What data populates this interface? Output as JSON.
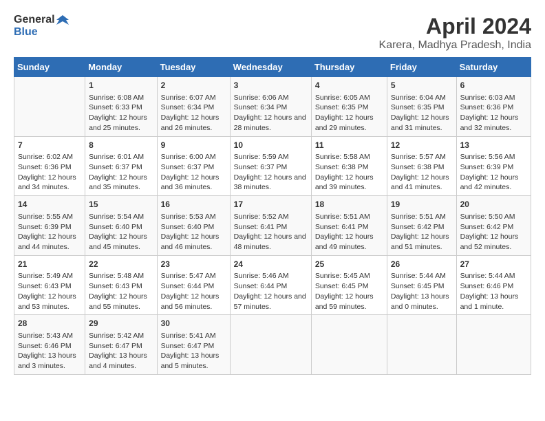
{
  "header": {
    "logo_general": "General",
    "logo_blue": "Blue",
    "title": "April 2024",
    "subtitle": "Karera, Madhya Pradesh, India"
  },
  "columns": [
    "Sunday",
    "Monday",
    "Tuesday",
    "Wednesday",
    "Thursday",
    "Friday",
    "Saturday"
  ],
  "weeks": [
    [
      {
        "day": "",
        "sunrise": "",
        "sunset": "",
        "daylight": ""
      },
      {
        "day": "1",
        "sunrise": "Sunrise: 6:08 AM",
        "sunset": "Sunset: 6:33 PM",
        "daylight": "Daylight: 12 hours and 25 minutes."
      },
      {
        "day": "2",
        "sunrise": "Sunrise: 6:07 AM",
        "sunset": "Sunset: 6:34 PM",
        "daylight": "Daylight: 12 hours and 26 minutes."
      },
      {
        "day": "3",
        "sunrise": "Sunrise: 6:06 AM",
        "sunset": "Sunset: 6:34 PM",
        "daylight": "Daylight: 12 hours and 28 minutes."
      },
      {
        "day": "4",
        "sunrise": "Sunrise: 6:05 AM",
        "sunset": "Sunset: 6:35 PM",
        "daylight": "Daylight: 12 hours and 29 minutes."
      },
      {
        "day": "5",
        "sunrise": "Sunrise: 6:04 AM",
        "sunset": "Sunset: 6:35 PM",
        "daylight": "Daylight: 12 hours and 31 minutes."
      },
      {
        "day": "6",
        "sunrise": "Sunrise: 6:03 AM",
        "sunset": "Sunset: 6:36 PM",
        "daylight": "Daylight: 12 hours and 32 minutes."
      }
    ],
    [
      {
        "day": "7",
        "sunrise": "Sunrise: 6:02 AM",
        "sunset": "Sunset: 6:36 PM",
        "daylight": "Daylight: 12 hours and 34 minutes."
      },
      {
        "day": "8",
        "sunrise": "Sunrise: 6:01 AM",
        "sunset": "Sunset: 6:37 PM",
        "daylight": "Daylight: 12 hours and 35 minutes."
      },
      {
        "day": "9",
        "sunrise": "Sunrise: 6:00 AM",
        "sunset": "Sunset: 6:37 PM",
        "daylight": "Daylight: 12 hours and 36 minutes."
      },
      {
        "day": "10",
        "sunrise": "Sunrise: 5:59 AM",
        "sunset": "Sunset: 6:37 PM",
        "daylight": "Daylight: 12 hours and 38 minutes."
      },
      {
        "day": "11",
        "sunrise": "Sunrise: 5:58 AM",
        "sunset": "Sunset: 6:38 PM",
        "daylight": "Daylight: 12 hours and 39 minutes."
      },
      {
        "day": "12",
        "sunrise": "Sunrise: 5:57 AM",
        "sunset": "Sunset: 6:38 PM",
        "daylight": "Daylight: 12 hours and 41 minutes."
      },
      {
        "day": "13",
        "sunrise": "Sunrise: 5:56 AM",
        "sunset": "Sunset: 6:39 PM",
        "daylight": "Daylight: 12 hours and 42 minutes."
      }
    ],
    [
      {
        "day": "14",
        "sunrise": "Sunrise: 5:55 AM",
        "sunset": "Sunset: 6:39 PM",
        "daylight": "Daylight: 12 hours and 44 minutes."
      },
      {
        "day": "15",
        "sunrise": "Sunrise: 5:54 AM",
        "sunset": "Sunset: 6:40 PM",
        "daylight": "Daylight: 12 hours and 45 minutes."
      },
      {
        "day": "16",
        "sunrise": "Sunrise: 5:53 AM",
        "sunset": "Sunset: 6:40 PM",
        "daylight": "Daylight: 12 hours and 46 minutes."
      },
      {
        "day": "17",
        "sunrise": "Sunrise: 5:52 AM",
        "sunset": "Sunset: 6:41 PM",
        "daylight": "Daylight: 12 hours and 48 minutes."
      },
      {
        "day": "18",
        "sunrise": "Sunrise: 5:51 AM",
        "sunset": "Sunset: 6:41 PM",
        "daylight": "Daylight: 12 hours and 49 minutes."
      },
      {
        "day": "19",
        "sunrise": "Sunrise: 5:51 AM",
        "sunset": "Sunset: 6:42 PM",
        "daylight": "Daylight: 12 hours and 51 minutes."
      },
      {
        "day": "20",
        "sunrise": "Sunrise: 5:50 AM",
        "sunset": "Sunset: 6:42 PM",
        "daylight": "Daylight: 12 hours and 52 minutes."
      }
    ],
    [
      {
        "day": "21",
        "sunrise": "Sunrise: 5:49 AM",
        "sunset": "Sunset: 6:43 PM",
        "daylight": "Daylight: 12 hours and 53 minutes."
      },
      {
        "day": "22",
        "sunrise": "Sunrise: 5:48 AM",
        "sunset": "Sunset: 6:43 PM",
        "daylight": "Daylight: 12 hours and 55 minutes."
      },
      {
        "day": "23",
        "sunrise": "Sunrise: 5:47 AM",
        "sunset": "Sunset: 6:44 PM",
        "daylight": "Daylight: 12 hours and 56 minutes."
      },
      {
        "day": "24",
        "sunrise": "Sunrise: 5:46 AM",
        "sunset": "Sunset: 6:44 PM",
        "daylight": "Daylight: 12 hours and 57 minutes."
      },
      {
        "day": "25",
        "sunrise": "Sunrise: 5:45 AM",
        "sunset": "Sunset: 6:45 PM",
        "daylight": "Daylight: 12 hours and 59 minutes."
      },
      {
        "day": "26",
        "sunrise": "Sunrise: 5:44 AM",
        "sunset": "Sunset: 6:45 PM",
        "daylight": "Daylight: 13 hours and 0 minutes."
      },
      {
        "day": "27",
        "sunrise": "Sunrise: 5:44 AM",
        "sunset": "Sunset: 6:46 PM",
        "daylight": "Daylight: 13 hours and 1 minute."
      }
    ],
    [
      {
        "day": "28",
        "sunrise": "Sunrise: 5:43 AM",
        "sunset": "Sunset: 6:46 PM",
        "daylight": "Daylight: 13 hours and 3 minutes."
      },
      {
        "day": "29",
        "sunrise": "Sunrise: 5:42 AM",
        "sunset": "Sunset: 6:47 PM",
        "daylight": "Daylight: 13 hours and 4 minutes."
      },
      {
        "day": "30",
        "sunrise": "Sunrise: 5:41 AM",
        "sunset": "Sunset: 6:47 PM",
        "daylight": "Daylight: 13 hours and 5 minutes."
      },
      {
        "day": "",
        "sunrise": "",
        "sunset": "",
        "daylight": ""
      },
      {
        "day": "",
        "sunrise": "",
        "sunset": "",
        "daylight": ""
      },
      {
        "day": "",
        "sunrise": "",
        "sunset": "",
        "daylight": ""
      },
      {
        "day": "",
        "sunrise": "",
        "sunset": "",
        "daylight": ""
      }
    ]
  ]
}
